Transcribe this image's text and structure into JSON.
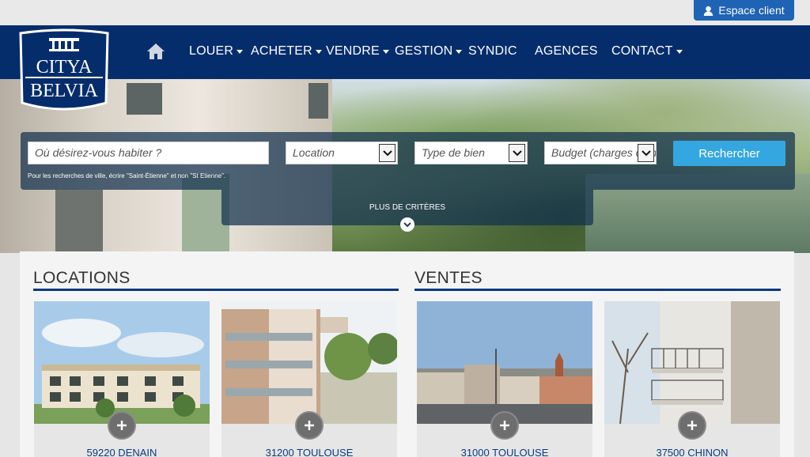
{
  "header": {
    "espace_client_label": "Espace client"
  },
  "logo": {
    "line1": "CITYA",
    "line2": "BELVIA"
  },
  "nav": {
    "items": [
      {
        "label": "LOUER",
        "has_dropdown": true
      },
      {
        "label": "ACHETER",
        "has_dropdown": true
      },
      {
        "label": "VENDRE",
        "has_dropdown": true
      },
      {
        "label": "GESTION",
        "has_dropdown": true
      },
      {
        "label": "SYNDIC",
        "has_dropdown": false
      },
      {
        "label": "AGENCES",
        "has_dropdown": false
      },
      {
        "label": "CONTACT",
        "has_dropdown": true
      }
    ]
  },
  "search": {
    "placeholder": "Où désirez-vous habiter ?",
    "transaction_select": "Location",
    "type_select": "Type de bien",
    "budget_select": "Budget (charges comprises)",
    "submit_label": "Rechercher",
    "hint": "Pour les recherches de ville, écrire \"Saint-Étienne\" et non \"St Etienne\".",
    "more_criteria_label": "PLUS DE CRITÈRES"
  },
  "sections": {
    "locations": {
      "title": "LOCATIONS",
      "cards": [
        {
          "city": "59220 DENAIN"
        },
        {
          "city": "31200 TOULOUSE"
        }
      ]
    },
    "ventes": {
      "title": "VENTES",
      "cards": [
        {
          "city": "31000 TOULOUSE"
        },
        {
          "city": "37500 CHINON"
        }
      ]
    }
  },
  "colors": {
    "navbar": "#062d6b",
    "accent_blue": "#1e63b4",
    "search_button": "#35a7e0",
    "section_rule": "#0b3a7e"
  },
  "icons": {
    "home": "home-icon",
    "user": "user-icon",
    "plus": "plus-icon",
    "chevron": "chevron-down-icon"
  }
}
